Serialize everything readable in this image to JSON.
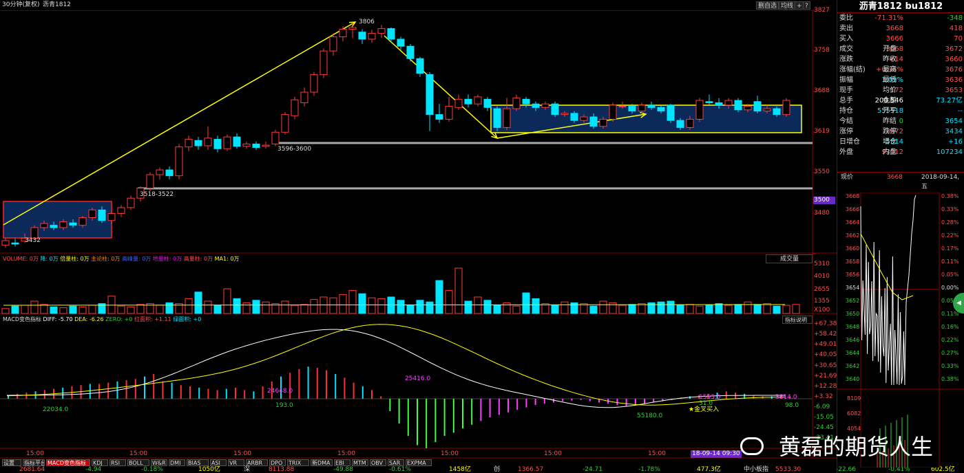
{
  "header": {
    "period": "30分钟(复权)",
    "symbol": "沥青1812",
    "buttons": [
      "删自选",
      "均线",
      "+",
      "?"
    ]
  },
  "price_axis": [
    "3827",
    "3758",
    "3688",
    "3619",
    "3550",
    "3500",
    "3480"
  ],
  "annotations": {
    "peak": "3806",
    "low": "3432",
    "level1": "3596-3600",
    "level2": "3518-3522"
  },
  "candles": [
    [
      8,
      3428,
      3436,
      3424,
      3440
    ],
    [
      22,
      3432,
      3430,
      3426,
      3440
    ],
    [
      36,
      3435,
      3440,
      3432,
      3448
    ],
    [
      50,
      3440,
      3458,
      3436,
      3462
    ],
    [
      64,
      3458,
      3465,
      3452,
      3470
    ],
    [
      78,
      3462,
      3458,
      3454,
      3468
    ],
    [
      92,
      3458,
      3468,
      3454,
      3472
    ],
    [
      106,
      3466,
      3462,
      3458,
      3472
    ],
    [
      120,
      3462,
      3475,
      3458,
      3478
    ],
    [
      134,
      3475,
      3488,
      3470,
      3492
    ],
    [
      148,
      3488,
      3470,
      3466,
      3494
    ],
    [
      162,
      3470,
      3482,
      3464,
      3486
    ],
    [
      176,
      3482,
      3492,
      3476,
      3496
    ],
    [
      190,
      3492,
      3508,
      3488,
      3512
    ],
    [
      204,
      3508,
      3525,
      3502,
      3528
    ],
    [
      218,
      3525,
      3548,
      3520,
      3552
    ],
    [
      232,
      3548,
      3556,
      3540,
      3560
    ],
    [
      246,
      3556,
      3546,
      3540,
      3562
    ],
    [
      260,
      3546,
      3595,
      3540,
      3600
    ],
    [
      274,
      3595,
      3608,
      3588,
      3614
    ],
    [
      288,
      3606,
      3597,
      3590,
      3612
    ],
    [
      302,
      3597,
      3610,
      3590,
      3630
    ],
    [
      316,
      3608,
      3592,
      3586,
      3614
    ],
    [
      330,
      3592,
      3612,
      3588,
      3616
    ],
    [
      344,
      3612,
      3596,
      3592,
      3618
    ],
    [
      358,
      3596,
      3600,
      3592,
      3604
    ],
    [
      372,
      3600,
      3594,
      3590,
      3604
    ],
    [
      386,
      3596,
      3598,
      3592,
      3604
    ],
    [
      400,
      3600,
      3620,
      3596,
      3624
    ],
    [
      414,
      3620,
      3650,
      3616,
      3654
    ],
    [
      428,
      3648,
      3675,
      3642,
      3680
    ],
    [
      442,
      3670,
      3688,
      3664,
      3696
    ],
    [
      456,
      3688,
      3718,
      3682,
      3722
    ],
    [
      470,
      3718,
      3758,
      3712,
      3762
    ],
    [
      484,
      3758,
      3782,
      3750,
      3788
    ],
    [
      498,
      3782,
      3795,
      3774,
      3800
    ],
    [
      512,
      3795,
      3798,
      3780,
      3806
    ],
    [
      526,
      3790,
      3778,
      3770,
      3795
    ],
    [
      540,
      3778,
      3788,
      3772,
      3794
    ],
    [
      554,
      3788,
      3796,
      3780,
      3802
    ],
    [
      568,
      3796,
      3778,
      3772,
      3798
    ],
    [
      582,
      3778,
      3766,
      3760,
      3782
    ],
    [
      596,
      3766,
      3745,
      3740,
      3770
    ],
    [
      610,
      3745,
      3720,
      3714,
      3748
    ],
    [
      624,
      3718,
      3650,
      3622,
      3722
    ],
    [
      638,
      3650,
      3642,
      3636,
      3668
    ],
    [
      652,
      3642,
      3664,
      3638,
      3680
    ],
    [
      666,
      3662,
      3676,
      3658,
      3684
    ],
    [
      680,
      3676,
      3668,
      3662,
      3684
    ],
    [
      694,
      3668,
      3680,
      3664,
      3684
    ],
    [
      708,
      3676,
      3662,
      3656,
      3680
    ],
    [
      722,
      3660,
      3628,
      3622,
      3664
    ],
    [
      736,
      3628,
      3660,
      3624,
      3678
    ],
    [
      750,
      3660,
      3678,
      3656,
      3684
    ],
    [
      764,
      3676,
      3668,
      3662,
      3680
    ],
    [
      778,
      3668,
      3662,
      3656,
      3672
    ],
    [
      792,
      3662,
      3668,
      3658,
      3672
    ],
    [
      806,
      3668,
      3650,
      3646,
      3672
    ],
    [
      820,
      3650,
      3652,
      3646,
      3656
    ],
    [
      834,
      3652,
      3640,
      3636,
      3656
    ],
    [
      848,
      3640,
      3646,
      3636,
      3650
    ],
    [
      862,
      3646,
      3630,
      3626,
      3652
    ],
    [
      876,
      3630,
      3642,
      3626,
      3646
    ],
    [
      890,
      3642,
      3666,
      3638,
      3670
    ],
    [
      904,
      3664,
      3664,
      3660,
      3672
    ],
    [
      918,
      3664,
      3656,
      3652,
      3668
    ],
    [
      932,
      3656,
      3666,
      3652,
      3670
    ],
    [
      946,
      3666,
      3662,
      3658,
      3672
    ],
    [
      960,
      3662,
      3656,
      3652,
      3666
    ],
    [
      974,
      3666,
      3640,
      3636,
      3668
    ],
    [
      988,
      3640,
      3628,
      3624,
      3644
    ],
    [
      1002,
      3628,
      3642,
      3624,
      3648
    ],
    [
      1016,
      3642,
      3674,
      3638,
      3678
    ],
    [
      1030,
      3672,
      3670,
      3666,
      3684
    ],
    [
      1044,
      3670,
      3666,
      3660,
      3678
    ],
    [
      1058,
      3666,
      3674,
      3660,
      3678
    ],
    [
      1072,
      3674,
      3658,
      3654,
      3678
    ],
    [
      1086,
      3658,
      3664,
      3654,
      3668
    ],
    [
      1100,
      3672,
      3656,
      3652,
      3682
    ],
    [
      1114,
      3656,
      3660,
      3652,
      3666
    ],
    [
      1128,
      3660,
      3650,
      3646,
      3664
    ],
    [
      1142,
      3650,
      3674,
      3646,
      3678
    ]
  ],
  "volume": {
    "title_items": [
      "VOLUME: 0万",
      "降: 0万",
      "倍量柱: 0万",
      "主论柱: 0万",
      "高峰量: 0万",
      "地量柱: 0万",
      "高量柱: 0万",
      "MA1: 0万"
    ],
    "dropdown": "成交量",
    "axis": [
      "5310",
      "4010",
      "2655",
      "1355",
      "X100"
    ],
    "bars": [
      12,
      18,
      20,
      30,
      22,
      16,
      14,
      18,
      16,
      20,
      24,
      42,
      18,
      16,
      22,
      24,
      20,
      26,
      24,
      36,
      52,
      30,
      20,
      60,
      36,
      26,
      32,
      28,
      24,
      30,
      20,
      22,
      34,
      40,
      38,
      46,
      56,
      48,
      38,
      36,
      40,
      32,
      20,
      32,
      28,
      80,
      56,
      110,
      30,
      40,
      32,
      20,
      26,
      18,
      50,
      36,
      24,
      20,
      28,
      26,
      24,
      18,
      30,
      26,
      20,
      22,
      24,
      26,
      28,
      30,
      20,
      22,
      18,
      20,
      24,
      20,
      22,
      28,
      22,
      24,
      18,
      20,
      22
    ]
  },
  "macd": {
    "title": "MACD变色指标",
    "items": [
      "DIFF: -5.70",
      "DEA: -6.26",
      "ZERO: +0",
      "红面积: +1.11",
      "绿面积: +0"
    ],
    "btn": "指标说明",
    "axis": [
      "+67.38",
      "+58.42",
      "+49.01",
      "+40.05",
      "+30.65",
      "+21.69",
      "+12.28",
      "+3.32",
      "-6.09",
      "-15.05",
      "-24.45",
      "-33.41"
    ],
    "labels": [
      "22034.0",
      "193.0",
      "24648.0",
      "25416.0",
      "55180.0",
      "1553.0",
      "3814.0",
      "98.0",
      "31.0"
    ],
    "signal": "★金叉买入",
    "hist": [
      6,
      8,
      10,
      12,
      14,
      16,
      18,
      20,
      22,
      24,
      24,
      26,
      28,
      30,
      32,
      36,
      40,
      28,
      26,
      22,
      20,
      18,
      16,
      14,
      16,
      18,
      14,
      12,
      20,
      28,
      36,
      42,
      48,
      52,
      50,
      46,
      40,
      34,
      26,
      20,
      14,
      4,
      -20,
      -40,
      -60,
      -75,
      -80,
      -70,
      -60,
      -55,
      -48,
      -42,
      -36,
      -30,
      -26,
      -22,
      -18,
      -14,
      -10,
      -8,
      -6,
      -4,
      -3,
      -2,
      -4,
      -6,
      -8,
      -10,
      -12,
      -10,
      -8,
      -6,
      -4,
      -2,
      2,
      4,
      6,
      8,
      10,
      12,
      10,
      8,
      6,
      4,
      4,
      4,
      4
    ]
  },
  "time_axis": [
    "15:00",
    "15:00",
    "15:00",
    "15:00",
    "15:00",
    "15:00",
    "15:00"
  ],
  "time_stamp": "18-09-14 09:30",
  "tabs": [
    "设置",
    "指标平台",
    "MACD变色指标",
    "KDJ",
    "RSI",
    "BOLL",
    "W&R",
    "DMI",
    "BIAS",
    "ASI",
    "VR",
    "ARBR",
    "DPO",
    "TRIX",
    "新DMA",
    "EBI",
    "MTM",
    "OBV",
    "SAR",
    "EXPMA"
  ],
  "statusbar": [
    "2681.64",
    "-4.94",
    "-0.18%",
    "1050亿",
    "深",
    "8113.88",
    "-49.88",
    "-0.61%",
    "1458亿",
    "创",
    "1366.57",
    "-24.71",
    "-1.78%",
    "477.3亿",
    "中小板指",
    "5533.30",
    "-22.66",
    "-0.41%",
    "602.5亿"
  ],
  "quote": {
    "title": "沥青1812 bu1812",
    "rows": [
      [
        "委比",
        "-71.31%",
        "",
        "-348"
      ],
      [
        "卖出",
        "3668",
        "",
        "418"
      ],
      [
        "买入",
        "3666",
        "",
        "70"
      ],
      [
        "成交",
        "3668",
        "开盘",
        "3672"
      ],
      [
        "涨跌",
        "+14",
        "昨收",
        "3660"
      ],
      [
        "涨幅(结)",
        "+0.38%",
        "最高",
        "3676"
      ],
      [
        "振幅",
        "1.09%",
        "最低",
        "3636"
      ],
      [
        "现手",
        "172",
        "均价",
        "3653"
      ],
      [
        "总手",
        "200,546",
        "金额",
        "73.27亿"
      ],
      [
        "持仓",
        "555518",
        "开平",
        "--"
      ],
      [
        "今结",
        "0",
        "昨结",
        "3654"
      ],
      [
        "涨停",
        "3872",
        "跌停",
        "3434"
      ],
      [
        "日增仓",
        "-5314",
        "增仓",
        "+16"
      ],
      [
        "外盘",
        "93312",
        "内盘",
        "107234"
      ]
    ],
    "now_label": "现价",
    "now": "3668",
    "date": "2018-09-14,五",
    "left_axis": [
      "3668",
      "3666",
      "3664",
      "3662",
      "3660",
      "3658",
      "3656",
      "3654",
      "3652",
      "3650",
      "3648",
      "3646",
      "3644",
      "3642",
      "3640"
    ],
    "right_axis": [
      "0.38%",
      "0.33%",
      "0.28%",
      "0.22%",
      "0.17%",
      "0.11%",
      "0.05%",
      "0.00%",
      "0.05%",
      "0.11%",
      "0.16%",
      "0.22%",
      "0.27%",
      "0.33%",
      "0.38%"
    ],
    "vol_axis": [
      "8109",
      "6082",
      "4054"
    ]
  },
  "watermark": "黄磊的期货人生",
  "colors": {
    "up": "#ff3a3a",
    "down": "#00e5ff",
    "bg": "#000000",
    "yellow": "#ffff00"
  }
}
